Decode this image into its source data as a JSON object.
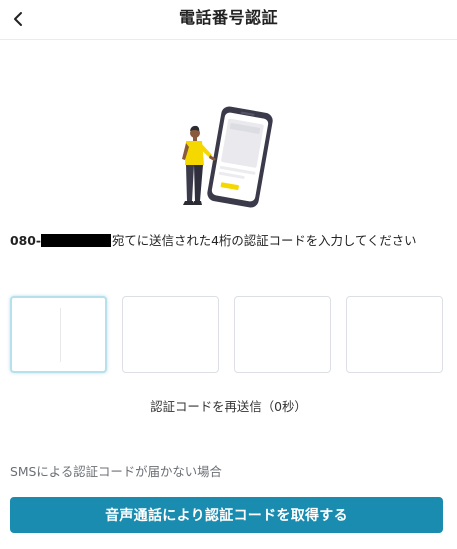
{
  "header": {
    "title": "電話番号認証",
    "back_icon": "chevron-left-icon"
  },
  "message": {
    "phone_prefix": "080-",
    "text": "宛てに送信された4桁の認証コードを入力してください"
  },
  "code_inputs": [
    {
      "value": "",
      "active": true
    },
    {
      "value": "",
      "active": false
    },
    {
      "value": "",
      "active": false
    },
    {
      "value": "",
      "active": false
    }
  ],
  "resend": {
    "label": "認証コードを再送信（0秒）"
  },
  "sms_help": {
    "text": "SMSによる認証コードが届かない場合"
  },
  "voice_button": {
    "label": "音声通話により認証コードを取得する"
  },
  "colors": {
    "accent": "#1a8cb0",
    "active_border": "#b6e0ea",
    "illustration_yellow": "#f5d800",
    "illustration_dark": "#3a3a4a"
  }
}
